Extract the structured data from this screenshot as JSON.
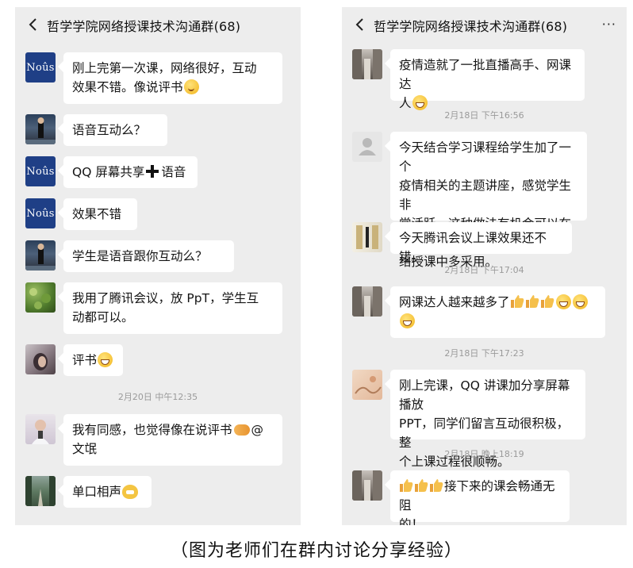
{
  "left_panel": {
    "title": "哲学学院网络授课技术沟通群(68)",
    "avatar_text": "Noûs",
    "messages": [
      {
        "line1": "刚上完第一次课，网络很好，互动",
        "line2": "效果不错。像说评书"
      },
      {
        "text": "语音互动么？"
      },
      {
        "before": "QQ 屏幕共享",
        "after": "语音"
      },
      {
        "text": "效果不错"
      },
      {
        "text": "学生是语音跟你互动么？"
      },
      {
        "line1": "我用了腾讯会议，放 PpT，学生互",
        "line2": "动都可以。"
      },
      {
        "text": "评书"
      },
      {
        "line1": "我有同感，也觉得像在说评书",
        "line1_end": "@",
        "line2": "文氓"
      },
      {
        "text": "单口相声"
      }
    ],
    "timestamp": "2月20日 中午12:35"
  },
  "right_panel": {
    "title": "哲学学院网络授课技术沟通群(68)",
    "more": "···",
    "messages": [
      {
        "line1": "疫情造就了一批直播高手、网课达",
        "line2": "人"
      },
      {
        "line1": "今天结合学习课程给学生加了一个",
        "line2": "疫情相关的主题讲座，感觉学生非",
        "line3": "常活跃，这种做法有机会可以在网",
        "line4": "络授课中多采用。"
      },
      {
        "text": "今天腾讯会议上课效果还不错。"
      },
      {
        "text": "网课达人越来越多了"
      },
      {
        "line1": "刚上完课，QQ 讲课加分享屏幕播放",
        "line2": "PPT，同学们留言互动很积极，整",
        "line3": "个上课过程很顺畅。"
      },
      {
        "text": "接下来的课会畅通无阻",
        "line2": "的！"
      }
    ],
    "timestamps": [
      "2月18日 下午16:56",
      "2月18日 下午17:04",
      "2月18日 下午17:23",
      "2月18日 晚上18:19"
    ]
  },
  "caption": "（图为老师们在群内讨论分享经验）",
  "colors": {
    "chat_bg": "#ededed",
    "bubble": "#ffffff",
    "nous_avatar": "#1f3f86",
    "timestamp": "#9a9a9a"
  },
  "icons": [
    "back-chevron-icon",
    "more-dots-icon",
    "grin-emoji-icon",
    "shy-emoji-icon",
    "plus-icon",
    "thumbs-up-icon",
    "handshake-icon",
    "cat-emoji-icon",
    "default-user-avatar-icon"
  ]
}
